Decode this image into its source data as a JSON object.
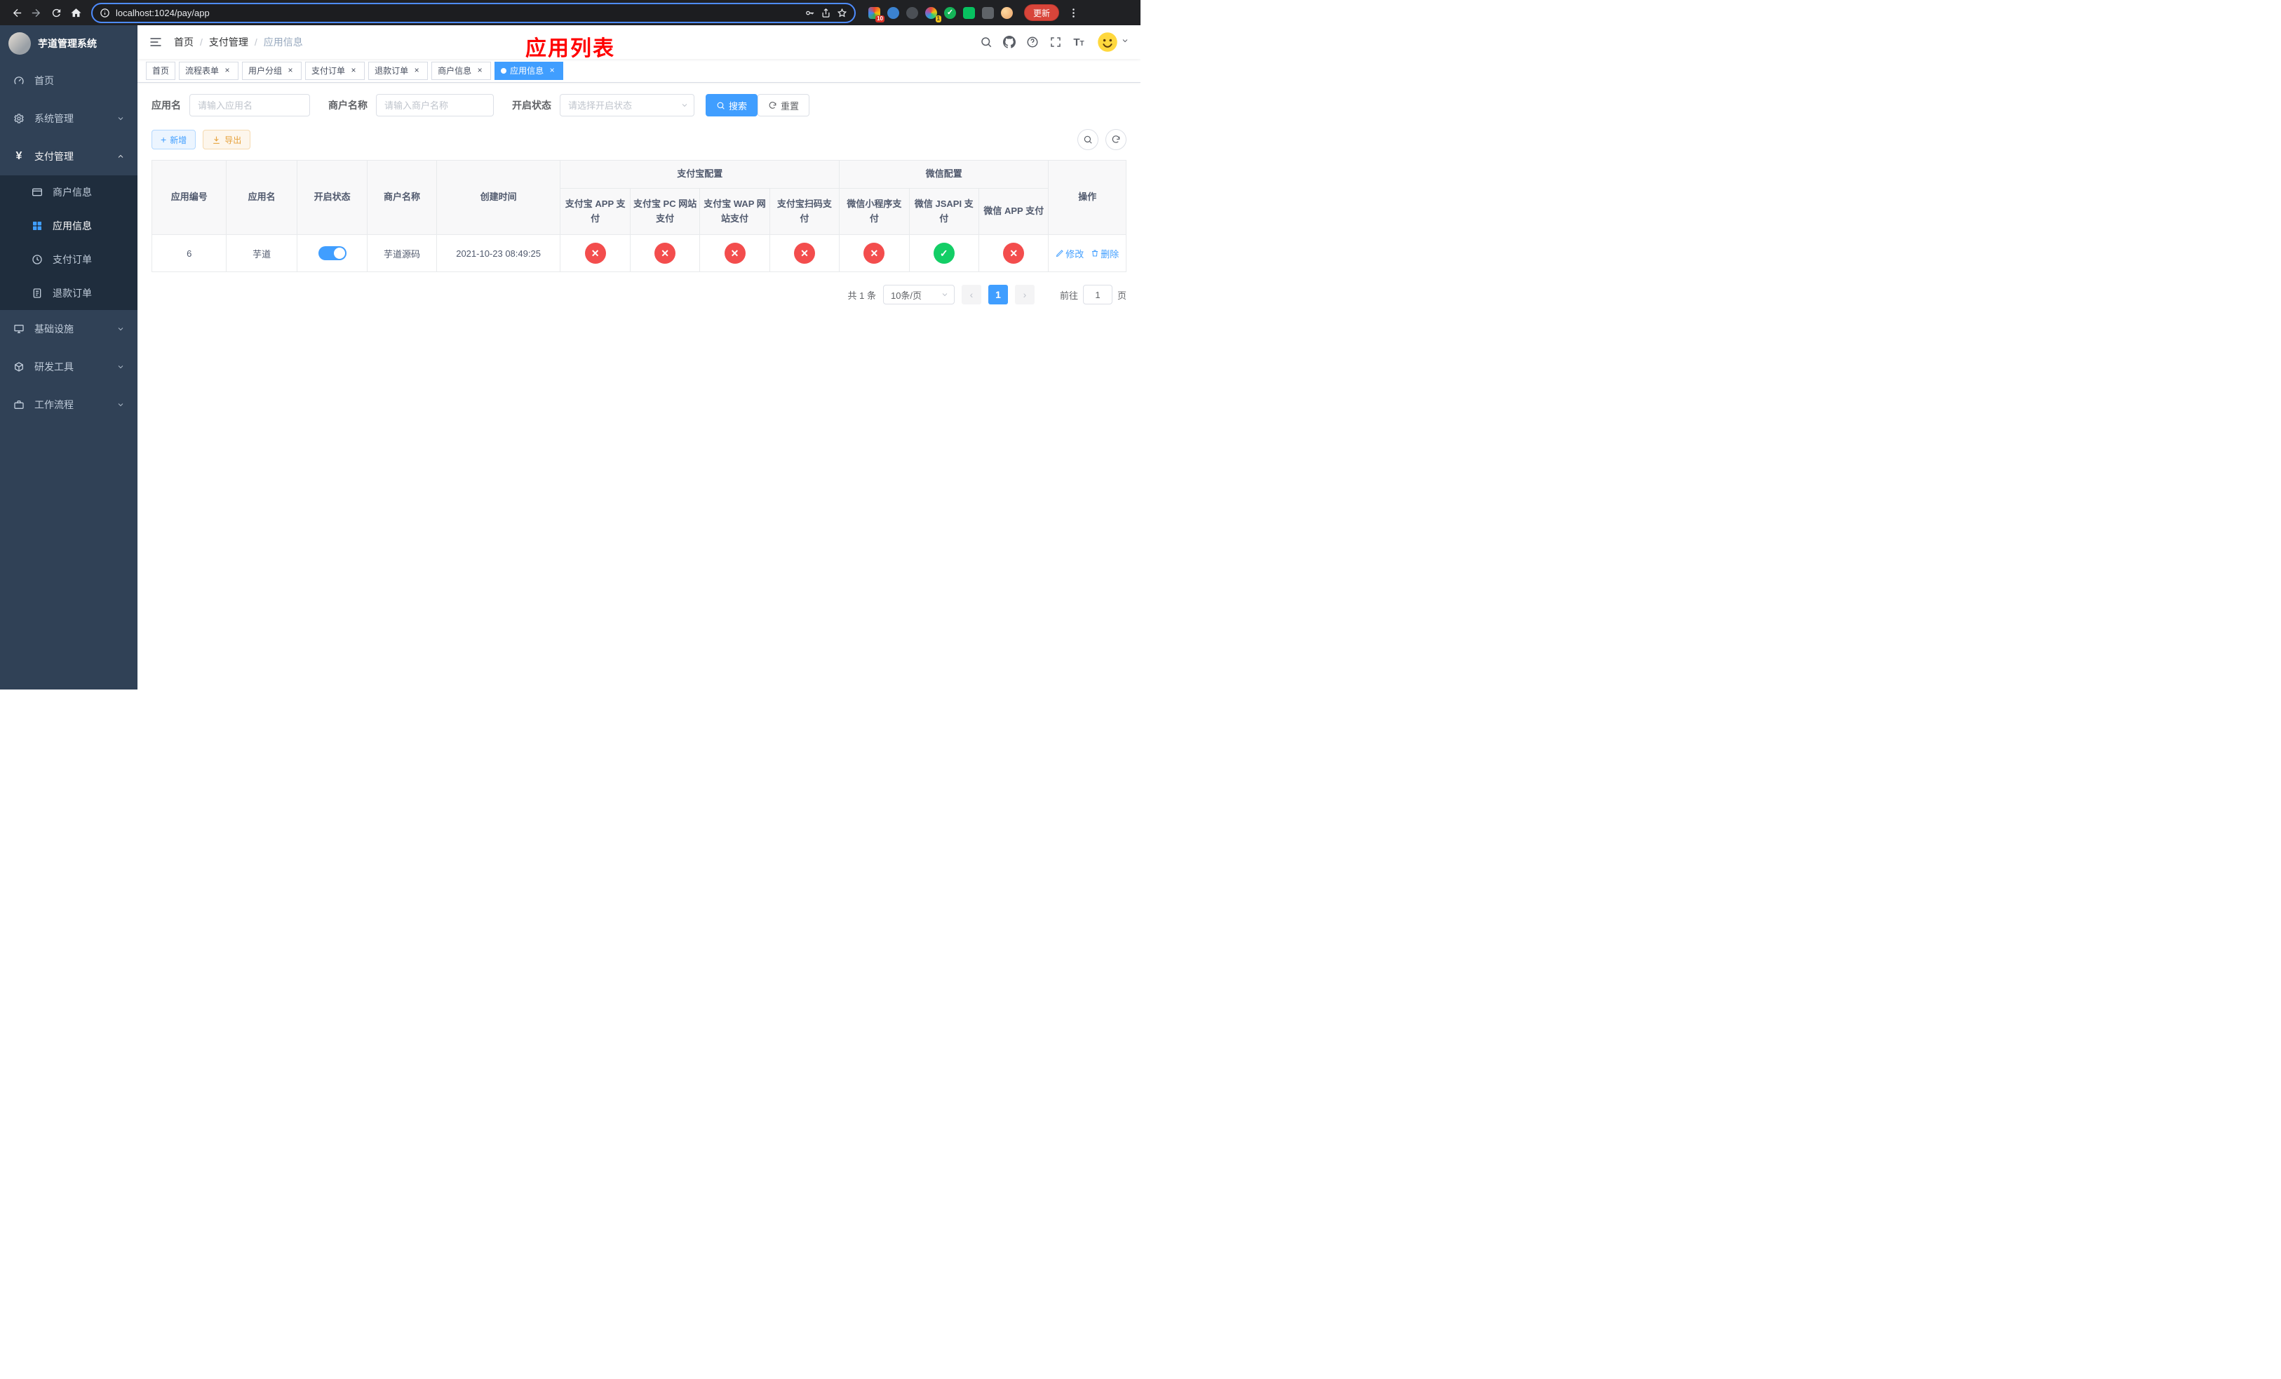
{
  "colors": {
    "accent": "#409eff",
    "success": "#13ce66",
    "fail": "#f34d4d",
    "warning": "#e6a23c",
    "page_title_red": "#ff0000"
  },
  "browser": {
    "url": "localhost:1024/pay/app",
    "update_button": "更新",
    "extension_badge_1": "10",
    "extension_badge_2": "1"
  },
  "sidebar": {
    "title": "芋道管理系统",
    "items": [
      {
        "label": "首页"
      },
      {
        "label": "系统管理"
      },
      {
        "label": "支付管理",
        "children": [
          {
            "label": "商户信息"
          },
          {
            "label": "应用信息"
          },
          {
            "label": "支付订单"
          },
          {
            "label": "退款订单"
          }
        ]
      },
      {
        "label": "基础设施"
      },
      {
        "label": "研发工具"
      },
      {
        "label": "工作流程"
      }
    ]
  },
  "header": {
    "breadcrumb": [
      "首页",
      "支付管理",
      "应用信息"
    ],
    "page_title": "应用列表"
  },
  "tabs": [
    {
      "label": "首页"
    },
    {
      "label": "流程表单"
    },
    {
      "label": "用户分组"
    },
    {
      "label": "支付订单"
    },
    {
      "label": "退款订单"
    },
    {
      "label": "商户信息"
    },
    {
      "label": "应用信息"
    }
  ],
  "filters": {
    "app_name_label": "应用名",
    "app_name_placeholder": "请输入应用名",
    "merchant_label": "商户名称",
    "merchant_placeholder": "请输入商户名称",
    "status_label": "开启状态",
    "status_placeholder": "请选择开启状态",
    "search_button": "搜索",
    "reset_button": "重置"
  },
  "toolbar": {
    "add_button": "新增",
    "export_button": "导出"
  },
  "table": {
    "col_app_id": "应用编号",
    "col_app_name": "应用名",
    "col_status": "开启状态",
    "col_merchant": "商户名称",
    "col_created": "创建时间",
    "group_alipay": "支付宝配置",
    "group_wechat": "微信配置",
    "col_operations": "操作",
    "alipay_cols": [
      "支付宝 APP 支付",
      "支付宝 PC 网站支付",
      "支付宝 WAP 网站支付",
      "支付宝扫码支付"
    ],
    "wechat_cols": [
      "微信小程序支付",
      "微信 JSAPI 支付",
      "微信 APP 支付"
    ],
    "rows": [
      {
        "id": "6",
        "name": "芋道",
        "enabled": true,
        "merchant": "芋道源码",
        "created": "2021-10-23 08:49:25",
        "statuses": [
          "fail",
          "fail",
          "fail",
          "fail",
          "fail",
          "success",
          "fail"
        ],
        "edit_label": "修改",
        "delete_label": "删除"
      }
    ]
  },
  "pagination": {
    "total": "共 1 条",
    "page_size": "10条/页",
    "current_page": "1",
    "goto_label": "前往",
    "goto_value": "1",
    "unit": "页"
  }
}
